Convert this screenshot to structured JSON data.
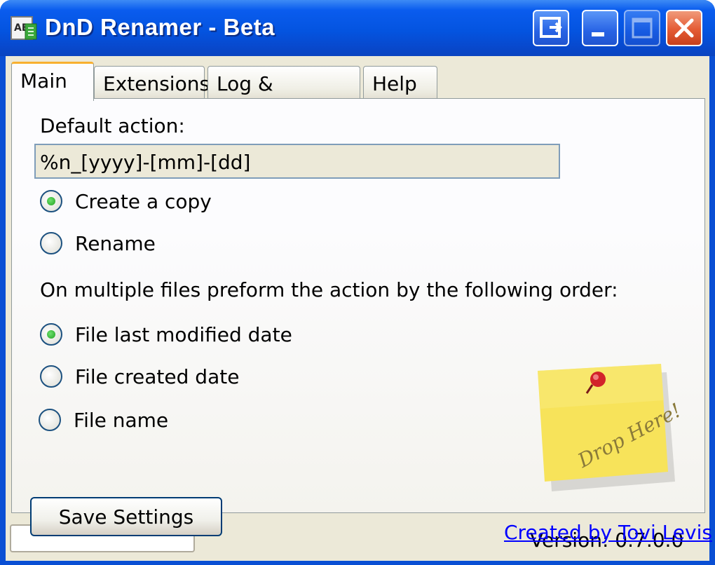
{
  "window": {
    "title": "DnD Renamer - Beta",
    "colors": {
      "titlebar": "#0454e0",
      "client_bg": "#ece9d8",
      "active_tab_accent": "#f8b030",
      "link": "#0000ff"
    }
  },
  "titlebar_buttons": [
    "tray-icon",
    "minimize-icon",
    "maximize-icon",
    "close-icon"
  ],
  "tabs": [
    {
      "label": "Main",
      "active": true
    },
    {
      "label": "Extensions",
      "active": false
    },
    {
      "label": "Log & Rollback",
      "active": false
    },
    {
      "label": "Help",
      "active": false
    }
  ],
  "main": {
    "default_action_label": "Default action:",
    "default_action_value": "%n_[yyyy]-[mm]-[dd]",
    "action_options": [
      {
        "label": "Create a copy",
        "selected": true
      },
      {
        "label": "Rename",
        "selected": false
      }
    ],
    "order_label": "On multiple files preform the action by the following order:",
    "order_options": [
      {
        "label": "File last modified date",
        "selected": true
      },
      {
        "label": "File created date",
        "selected": false
      },
      {
        "label": "File name",
        "selected": false
      }
    ],
    "save_button": "Save Settings",
    "drop_note": "Drop Here!",
    "credit_link": "Created by Tovi Levis"
  },
  "status": {
    "field_value": "",
    "version": "Version: 0.7.0.0"
  }
}
